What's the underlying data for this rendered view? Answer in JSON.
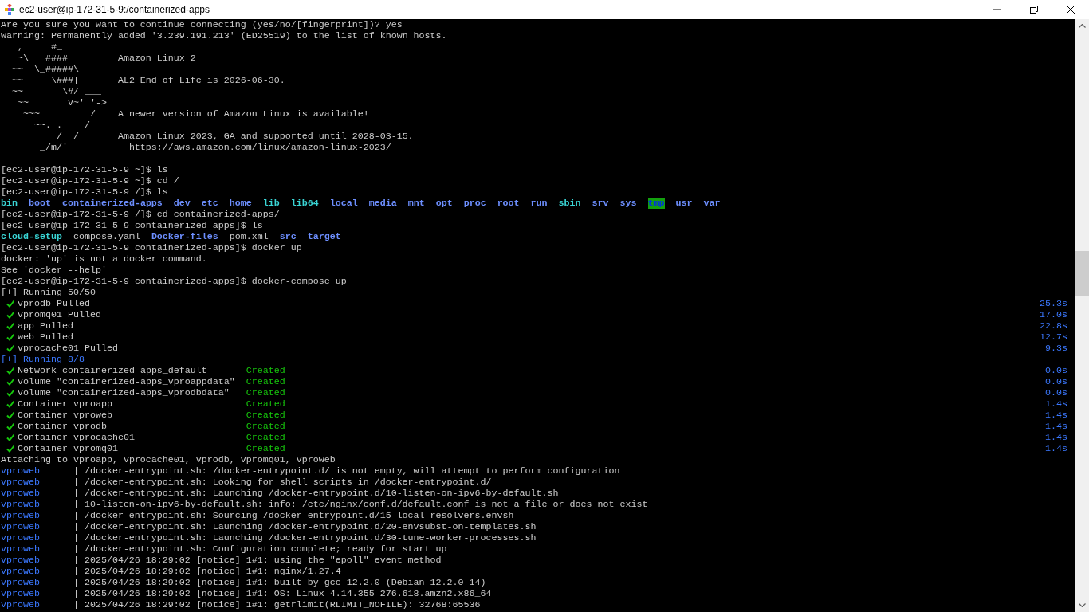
{
  "window": {
    "title": "ec2-user@ip-172-31-5-9:/containerized-apps"
  },
  "terminal": {
    "lines": [
      {
        "kind": "text",
        "text": "Are you sure you want to continue connecting (yes/no/[fingerprint])? yes"
      },
      {
        "kind": "text",
        "text": "Warning: Permanently added '3.239.191.213' (ED25519) to the list of known hosts."
      },
      {
        "kind": "art",
        "art": "   ,     #_"
      },
      {
        "kind": "motd",
        "art": "   ~\\_  ####_",
        "message": "Amazon Linux 2"
      },
      {
        "kind": "art",
        "art": "  ~~  \\_#####\\"
      },
      {
        "kind": "motd",
        "art": "  ~~     \\###|",
        "message": "AL2 End of Life is 2026-06-30."
      },
      {
        "kind": "art",
        "art": "  ~~       \\#/ ___"
      },
      {
        "kind": "art",
        "art": "   ~~       V~' '->"
      },
      {
        "kind": "motd",
        "art": "    ~~~         /",
        "message": "A newer version of Amazon Linux is available!"
      },
      {
        "kind": "art",
        "art": "      ~~._.   _/"
      },
      {
        "kind": "motd",
        "art": "         _/ _/",
        "message": "Amazon Linux 2023, GA and supported until 2028-03-15."
      },
      {
        "kind": "motd-link",
        "art": "       _/m/'",
        "message": "https://aws.amazon.com/linux/amazon-linux-2023/"
      },
      {
        "kind": "blank"
      },
      {
        "kind": "text",
        "text": "[ec2-user@ip-172-31-5-9 ~]$ ls"
      },
      {
        "kind": "text",
        "text": "[ec2-user@ip-172-31-5-9 ~]$ cd /"
      },
      {
        "kind": "text",
        "text": "[ec2-user@ip-172-31-5-9 /]$ ls"
      },
      {
        "kind": "listing",
        "items": [
          {
            "name": "bin",
            "kind": "link"
          },
          {
            "name": "boot",
            "kind": "dir"
          },
          {
            "name": "containerized-apps",
            "kind": "dir"
          },
          {
            "name": "dev",
            "kind": "dir"
          },
          {
            "name": "etc",
            "kind": "dir"
          },
          {
            "name": "home",
            "kind": "dir"
          },
          {
            "name": "lib",
            "kind": "link"
          },
          {
            "name": "lib64",
            "kind": "link"
          },
          {
            "name": "local",
            "kind": "dir"
          },
          {
            "name": "media",
            "kind": "dir"
          },
          {
            "name": "mnt",
            "kind": "dir"
          },
          {
            "name": "opt",
            "kind": "dir"
          },
          {
            "name": "proc",
            "kind": "dir"
          },
          {
            "name": "root",
            "kind": "dir"
          },
          {
            "name": "run",
            "kind": "dir"
          },
          {
            "name": "sbin",
            "kind": "link"
          },
          {
            "name": "srv",
            "kind": "dir"
          },
          {
            "name": "sys",
            "kind": "dir"
          },
          {
            "name": "tmp",
            "kind": "sticky"
          },
          {
            "name": "usr",
            "kind": "dir"
          },
          {
            "name": "var",
            "kind": "dir"
          }
        ]
      },
      {
        "kind": "text",
        "text": "[ec2-user@ip-172-31-5-9 /]$ cd containerized-apps/"
      },
      {
        "kind": "text",
        "text": "[ec2-user@ip-172-31-5-9 containerized-apps]$ ls"
      },
      {
        "kind": "listing",
        "items": [
          {
            "name": "cloud-setup",
            "kind": "link"
          },
          {
            "name": "compose.yaml",
            "kind": "file"
          },
          {
            "name": "Docker-files",
            "kind": "dir"
          },
          {
            "name": "pom.xml",
            "kind": "file"
          },
          {
            "name": "src",
            "kind": "dir"
          },
          {
            "name": "target",
            "kind": "dir"
          }
        ]
      },
      {
        "kind": "text",
        "text": "[ec2-user@ip-172-31-5-9 containerized-apps]$ docker up"
      },
      {
        "kind": "text",
        "text": "docker: 'up' is not a docker command."
      },
      {
        "kind": "text",
        "text": "See 'docker --help'"
      },
      {
        "kind": "text",
        "text": "[ec2-user@ip-172-31-5-9 containerized-apps]$ docker-compose up"
      },
      {
        "kind": "text",
        "text": "[+] Running 50/50"
      },
      {
        "kind": "step",
        "label": "vprodb Pulled",
        "time": "25.3s"
      },
      {
        "kind": "step",
        "label": "vpromq01 Pulled",
        "time": "17.0s"
      },
      {
        "kind": "step",
        "label": "app Pulled",
        "time": "22.8s"
      },
      {
        "kind": "step",
        "label": "web Pulled",
        "time": "12.7s"
      },
      {
        "kind": "step",
        "label": "vprocache01 Pulled",
        "time": "9.3s"
      },
      {
        "kind": "accent",
        "text": "[+] Running 8/8"
      },
      {
        "kind": "step",
        "label": "Network containerized-apps_default",
        "status": "Created",
        "time": "0.0s"
      },
      {
        "kind": "step",
        "label": "Volume \"containerized-apps_vproappdata\"",
        "status": "Created",
        "time": "0.0s"
      },
      {
        "kind": "step",
        "label": "Volume \"containerized-apps_vprodbdata\"",
        "status": "Created",
        "time": "0.0s"
      },
      {
        "kind": "step",
        "label": "Container vproapp",
        "status": "Created",
        "time": "1.4s"
      },
      {
        "kind": "step",
        "label": "Container vproweb",
        "status": "Created",
        "time": "1.4s"
      },
      {
        "kind": "step",
        "label": "Container vprodb",
        "status": "Created",
        "time": "1.4s"
      },
      {
        "kind": "step",
        "label": "Container vprocache01",
        "status": "Created",
        "time": "1.4s"
      },
      {
        "kind": "step",
        "label": "Container vpromq01",
        "status": "Created",
        "time": "1.4s"
      },
      {
        "kind": "text",
        "text": "Attaching to vproapp, vprocache01, vprodb, vpromq01, vproweb"
      },
      {
        "kind": "log",
        "service": "vproweb",
        "message": "| /docker-entrypoint.sh: /docker-entrypoint.d/ is not empty, will attempt to perform configuration"
      },
      {
        "kind": "log",
        "service": "vproweb",
        "message": "| /docker-entrypoint.sh: Looking for shell scripts in /docker-entrypoint.d/"
      },
      {
        "kind": "log",
        "service": "vproweb",
        "message": "| /docker-entrypoint.sh: Launching /docker-entrypoint.d/10-listen-on-ipv6-by-default.sh"
      },
      {
        "kind": "log",
        "service": "vproweb",
        "message": "| 10-listen-on-ipv6-by-default.sh: info: /etc/nginx/conf.d/default.conf is not a file or does not exist"
      },
      {
        "kind": "log",
        "service": "vproweb",
        "message": "| /docker-entrypoint.sh: Sourcing /docker-entrypoint.d/15-local-resolvers.envsh"
      },
      {
        "kind": "log",
        "service": "vproweb",
        "message": "| /docker-entrypoint.sh: Launching /docker-entrypoint.d/20-envsubst-on-templates.sh"
      },
      {
        "kind": "log",
        "service": "vproweb",
        "message": "| /docker-entrypoint.sh: Launching /docker-entrypoint.d/30-tune-worker-processes.sh"
      },
      {
        "kind": "log",
        "service": "vproweb",
        "message": "| /docker-entrypoint.sh: Configuration complete; ready for start up"
      },
      {
        "kind": "log",
        "service": "vproweb",
        "message": "| 2025/04/26 18:29:02 [notice] 1#1: using the \"epoll\" event method"
      },
      {
        "kind": "log",
        "service": "vproweb",
        "message": "| 2025/04/26 18:29:02 [notice] 1#1: nginx/1.27.4"
      },
      {
        "kind": "log",
        "service": "vproweb",
        "message": "| 2025/04/26 18:29:02 [notice] 1#1: built by gcc 12.2.0 (Debian 12.2.0-14)"
      },
      {
        "kind": "log",
        "service": "vproweb",
        "message": "| 2025/04/26 18:29:02 [notice] 1#1: OS: Linux 4.14.355-276.618.amzn2.x86_64"
      },
      {
        "kind": "log",
        "service": "vproweb",
        "message": "| 2025/04/26 18:29:02 [notice] 1#1: getrlimit(RLIMIT_NOFILE): 32768:65536"
      }
    ]
  }
}
